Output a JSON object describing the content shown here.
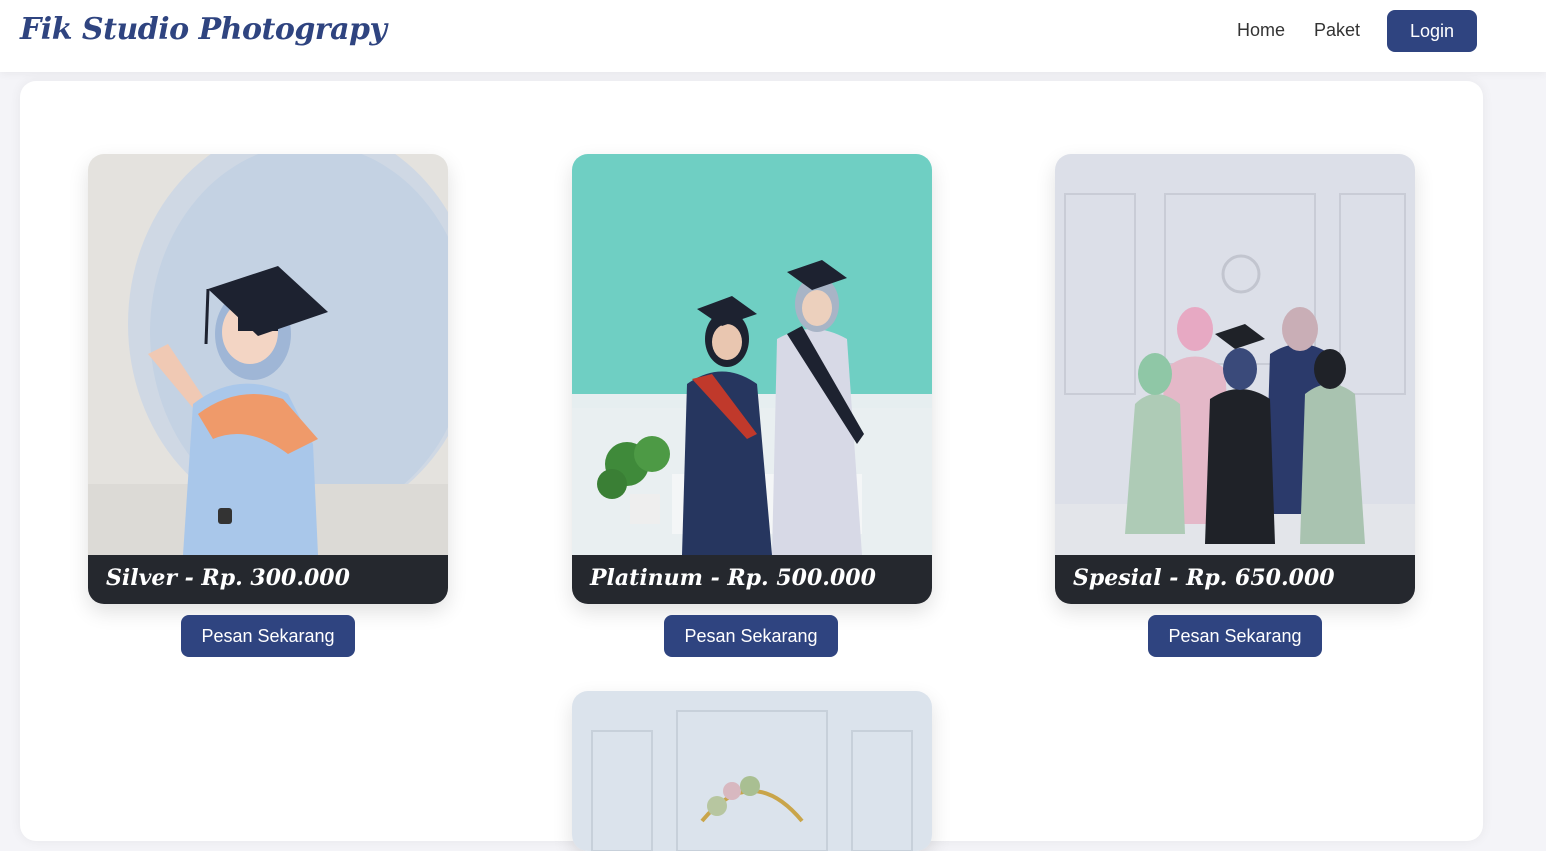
{
  "navbar": {
    "brand": "Fik Studio Photograpy",
    "links": [
      "Home",
      "Paket"
    ],
    "login_label": "Login"
  },
  "packages": [
    {
      "caption": "Silver - Rp. 300.000",
      "button_label": "Pesan Sekarang"
    },
    {
      "caption": "Platinum - Rp. 500.000",
      "button_label": "Pesan Sekarang"
    },
    {
      "caption": "Spesial - Rp. 650.000",
      "button_label": "Pesan Sekarang"
    }
  ],
  "colors": {
    "primary": "#2f4480",
    "caption_bg": "#25282e",
    "page_bg": "#f4f4f8"
  },
  "icons": [
    "graduation-photo-silver",
    "graduation-photo-platinum",
    "graduation-photo-spesial",
    "graduation-photo-partial"
  ]
}
